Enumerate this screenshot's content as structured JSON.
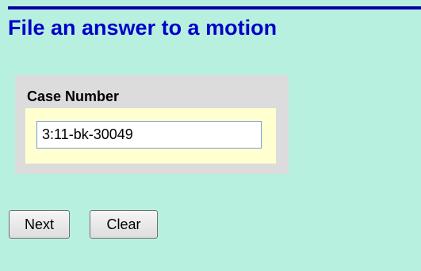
{
  "page": {
    "title": "File an answer to a motion"
  },
  "case_section": {
    "label": "Case Number",
    "case_number_value": "3:11-bk-30049"
  },
  "actions": {
    "next_label": "Next",
    "clear_label": "Clear"
  },
  "colors": {
    "background": "#b8f0e0",
    "title": "#0000c8",
    "top_rule": "#0000a0",
    "panel": "#dcdcdc",
    "field_highlight": "#ffffd0"
  }
}
